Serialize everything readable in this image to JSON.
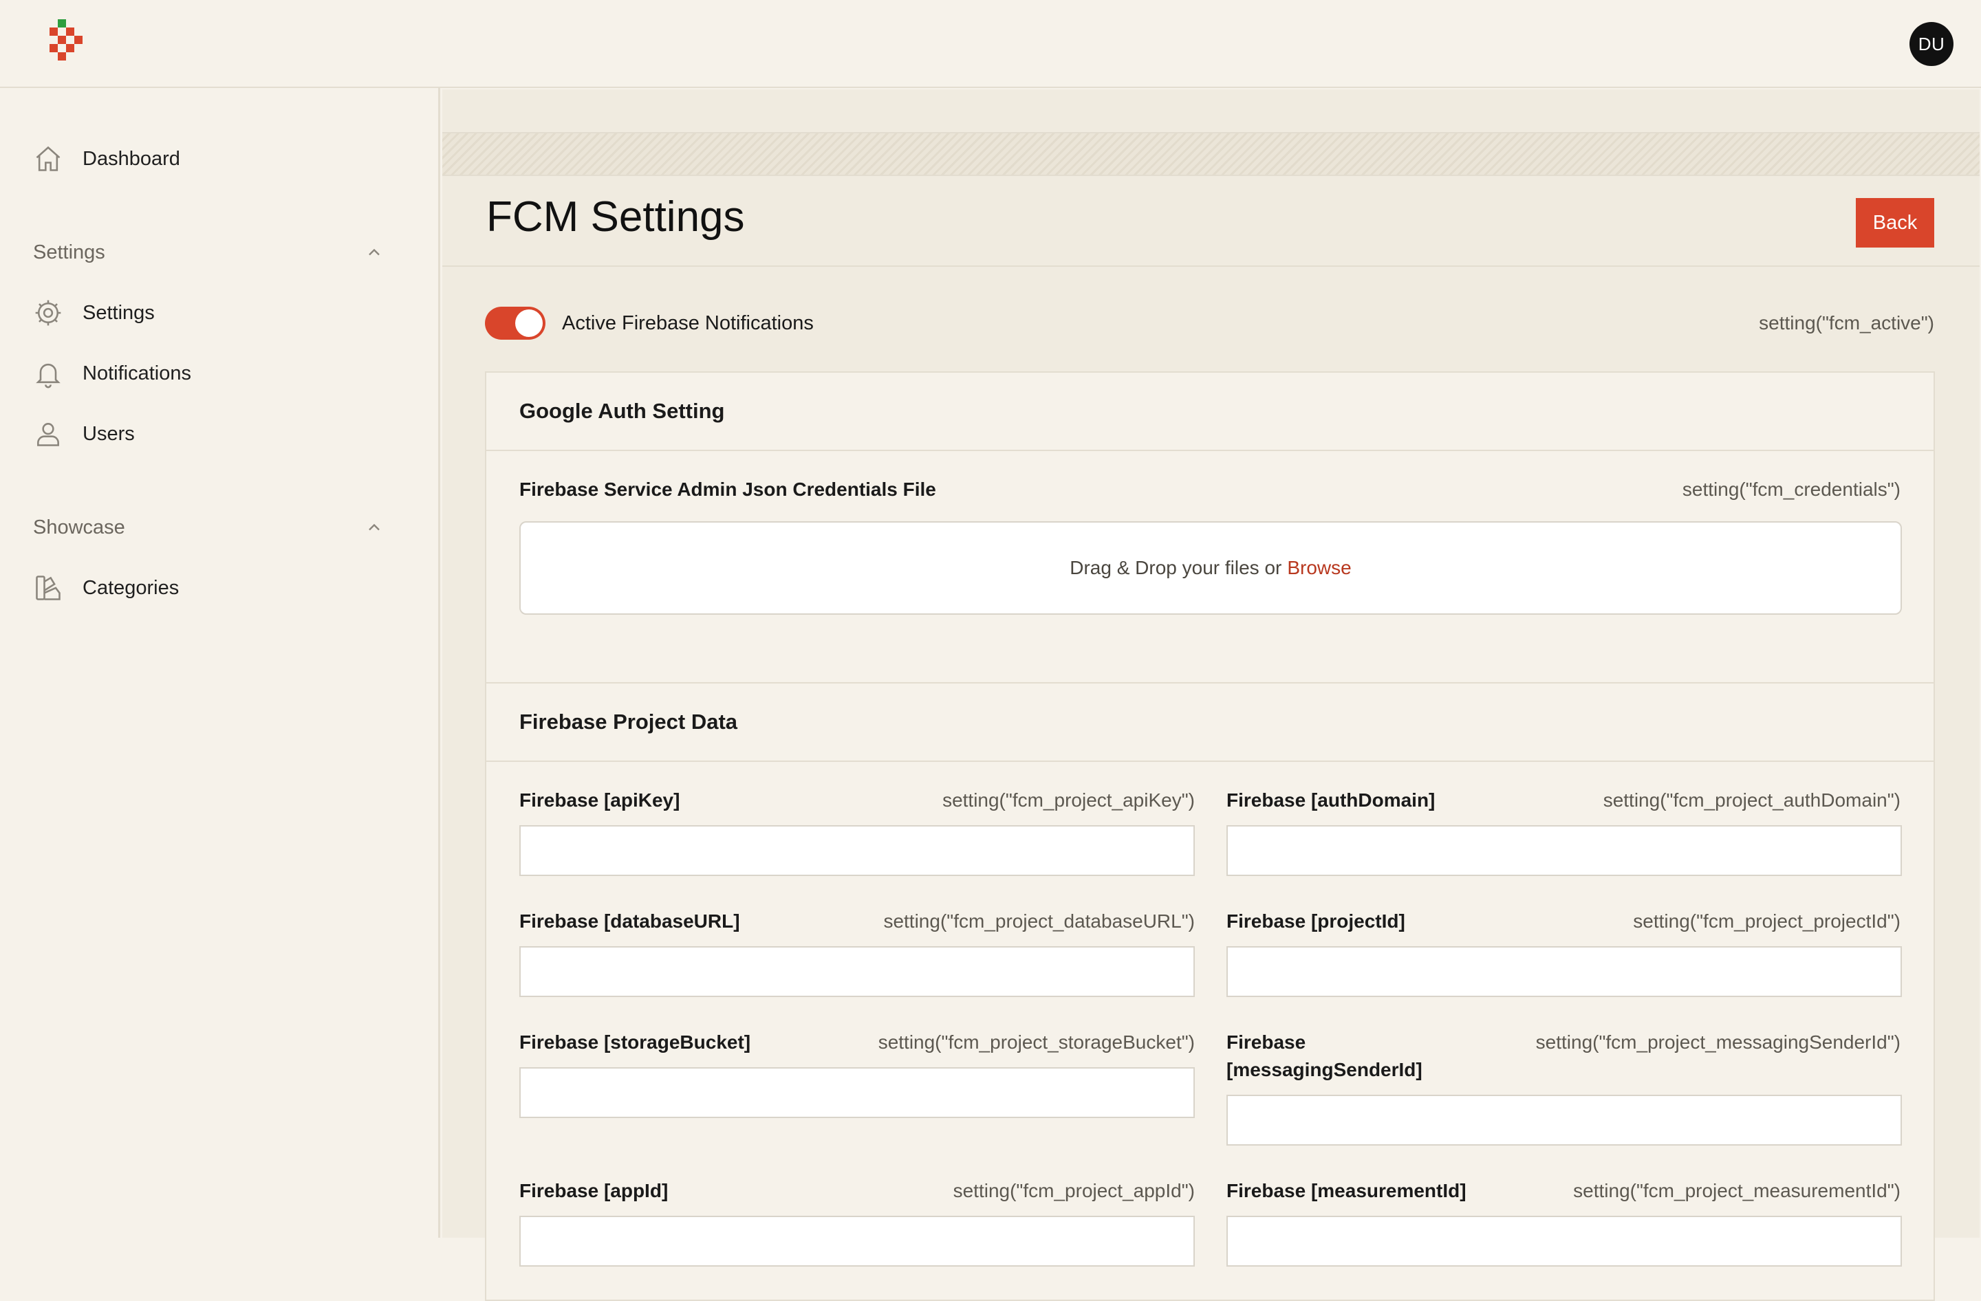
{
  "header": {
    "user_initials": "DU"
  },
  "sidebar": {
    "dashboard_label": "Dashboard",
    "sections": [
      {
        "label": "Settings"
      },
      {
        "label": "Showcase"
      }
    ],
    "items": [
      {
        "label": "Settings",
        "icon": "gear-icon"
      },
      {
        "label": "Notifications",
        "icon": "bell-icon"
      },
      {
        "label": "Users",
        "icon": "user-icon"
      },
      {
        "label": "Categories",
        "icon": "categories-icon"
      }
    ]
  },
  "page": {
    "title": "FCM Settings",
    "back_label": "Back",
    "toggle_label": "Active Firebase Notifications",
    "toggle_hint": "setting(\"fcm_active\")",
    "toggle_on": true
  },
  "google_auth": {
    "title": "Google Auth Setting",
    "file_label": "Firebase Service Admin Json Credentials File",
    "file_hint": "setting(\"fcm_credentials\")",
    "drop_text": "Drag & Drop your files or",
    "browse_label": "Browse"
  },
  "project": {
    "title": "Firebase Project Data",
    "fields": [
      {
        "label": "Firebase [apiKey]",
        "hint": "setting(\"fcm_project_apiKey\")",
        "value": ""
      },
      {
        "label": "Firebase [authDomain]",
        "hint": "setting(\"fcm_project_authDomain\")",
        "value": ""
      },
      {
        "label": "Firebase [databaseURL]",
        "hint": "setting(\"fcm_project_databaseURL\")",
        "value": ""
      },
      {
        "label": "Firebase [projectId]",
        "hint": "setting(\"fcm_project_projectId\")",
        "value": ""
      },
      {
        "label": "Firebase [storageBucket]",
        "hint": "setting(\"fcm_project_storageBucket\")",
        "value": ""
      },
      {
        "label": "Firebase [messagingSenderId]",
        "hint": "setting(\"fcm_project_messagingSenderId\")",
        "value": ""
      },
      {
        "label": "Firebase [appId]",
        "hint": "setting(\"fcm_project_appId\")",
        "value": ""
      },
      {
        "label": "Firebase [measurementId]",
        "hint": "setting(\"fcm_project_measurementId\")",
        "value": ""
      }
    ]
  },
  "colors": {
    "accent": "#d9452b",
    "background": "#f6f2ea",
    "panel": "#f0ebe0"
  }
}
